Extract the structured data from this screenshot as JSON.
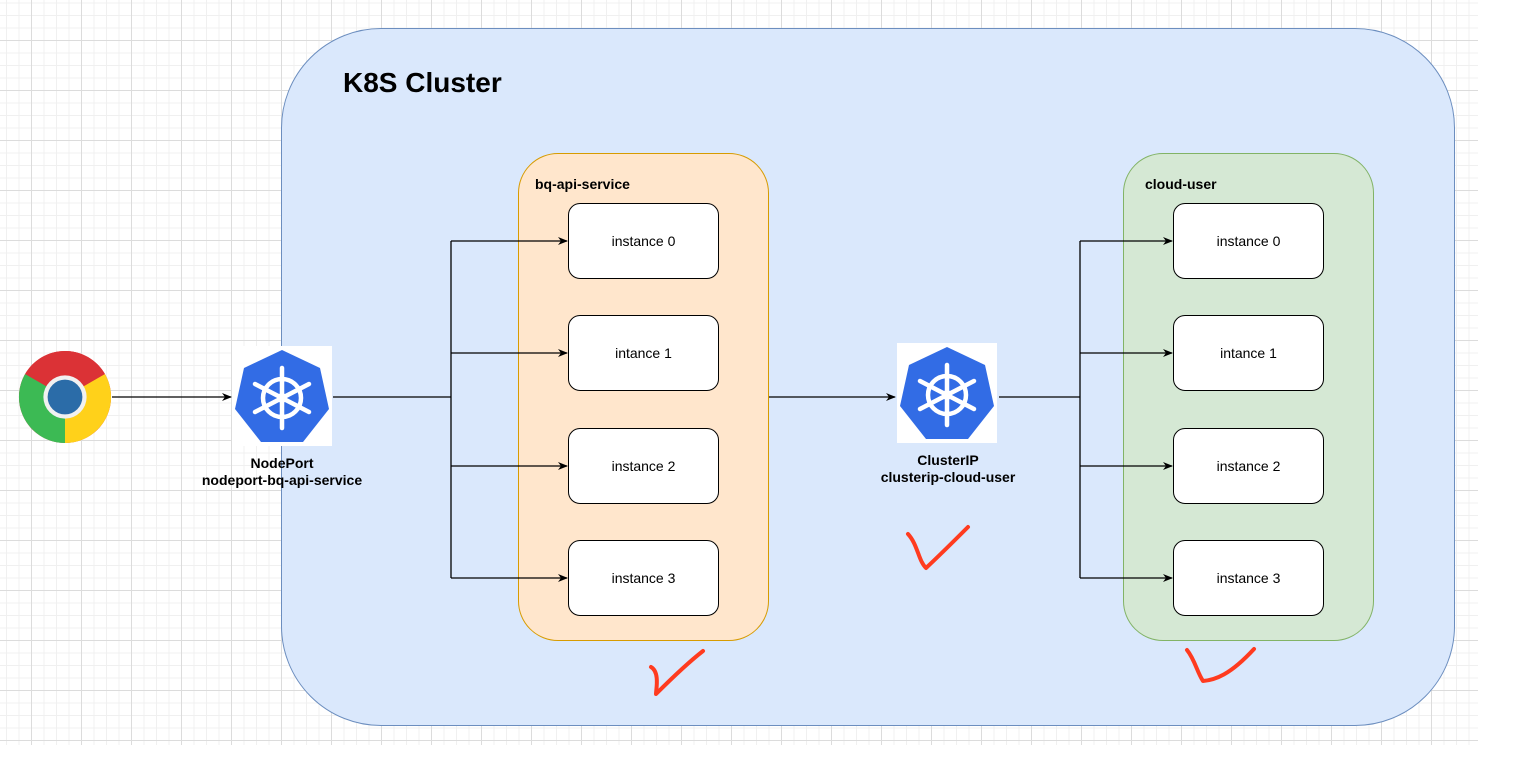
{
  "diagram": {
    "cluster": {
      "title": "K8S Cluster"
    },
    "client": {
      "icon": "chrome-browser-icon"
    },
    "nodeport": {
      "icon": "kubernetes-icon",
      "type": "NodePort",
      "name": "nodeport-bq-api-service"
    },
    "clusterip": {
      "icon": "kubernetes-icon",
      "type": "ClusterIP",
      "name": "clusterip-cloud-user"
    },
    "groups": [
      {
        "label": "bq-api-service",
        "color": "#ffe6cc",
        "instances": [
          "instance 0",
          "intance 1",
          "instance 2",
          "instance 3"
        ]
      },
      {
        "label": "cloud-user",
        "color": "#d5e8d4",
        "instances": [
          "instance 0",
          "intance 1",
          "instance 2",
          "instance 3"
        ]
      }
    ],
    "annotations": [
      {
        "type": "red-checkmark",
        "target": "bq-api-service"
      },
      {
        "type": "red-checkmark",
        "target": "clusterip-cloud-user"
      },
      {
        "type": "red-checkmark",
        "target": "cloud-user"
      }
    ],
    "colors": {
      "cluster_fill": "#dae8fc",
      "cluster_stroke": "#6c8ebf",
      "k8s_blue": "#326ce5",
      "check_red": "#ff3b1f"
    }
  }
}
